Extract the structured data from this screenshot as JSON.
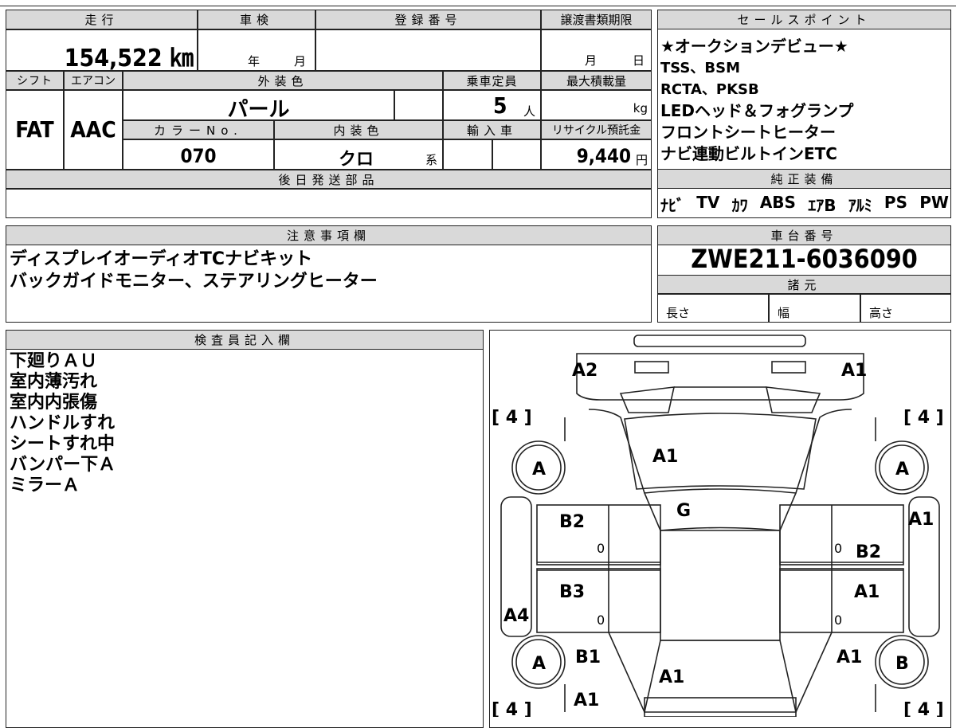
{
  "mileage": {
    "label": "走行",
    "value": "154,522 ㎞"
  },
  "inspection": {
    "label": "車検",
    "year": "年",
    "month": "月"
  },
  "registration": {
    "label": "登録番号"
  },
  "transfer_deadline": {
    "label": "譲渡書類期限",
    "month": "月",
    "day": "日"
  },
  "sales_points": {
    "label": "セールスポイント",
    "lines": [
      "★オークションデビュー★",
      "TSS、BSM",
      "RCTA、PKSB",
      "LEDヘッド＆フォグランプ",
      "フロントシートヒーター",
      "ナビ連動ビルトインETC"
    ]
  },
  "shift": {
    "label": "シフト",
    "value": "FAT"
  },
  "aircon": {
    "label": "エアコン",
    "value": "AAC"
  },
  "exterior_color": {
    "label": "外装色",
    "value": "パール"
  },
  "capacity": {
    "label": "乗車定員",
    "value": "5",
    "unit": "人"
  },
  "max_load": {
    "label": "最大積載量",
    "unit": "kg"
  },
  "color_no": {
    "label": "カラーNo.",
    "value": "070"
  },
  "interior_color": {
    "label": "内装色",
    "value": "クロ",
    "suffix": "系"
  },
  "import": {
    "label": "輸入車"
  },
  "recycle": {
    "label": "リサイクル預託金",
    "value": "9,440",
    "unit": "円"
  },
  "later_parts": {
    "label": "後日発送部品"
  },
  "genuine_equipment": {
    "label": "純正装備",
    "items": [
      "ﾅﾋﾞ",
      "TV",
      "ｶﾜ",
      "ABS",
      "ｴｱB",
      "ｱﾙﾐ",
      "PS",
      "PW"
    ]
  },
  "notes": {
    "label": "注意事項欄",
    "lines": [
      "ディスプレイオーディオTCナビキット",
      "バックガイドモニター、ステアリングヒーター"
    ]
  },
  "chassis": {
    "label": "車台番号",
    "value": "ZWE211-6036090"
  },
  "specs": {
    "label": "諸元",
    "length": "長さ",
    "width": "幅",
    "height": "高さ"
  },
  "inspector": {
    "label": "検査員記入欄",
    "lines": [
      "下廻りＡＵ",
      "室内薄汚れ",
      "室内内張傷",
      "ハンドルすれ",
      "シートすれ中",
      "バンパー下Ａ",
      "ミラーＡ"
    ]
  },
  "diagram": {
    "tread_fl": "[ 4 ]",
    "tread_fr": "[ 4 ]",
    "tread_rl": "[ 4 ]",
    "tread_rr": "[ 4 ]",
    "front_left_corner": "A2",
    "front_right_corner": "A1",
    "hood": "A1",
    "windshield": "G",
    "wheel_fl": "A",
    "wheel_fr": "A",
    "wheel_rl": "A",
    "wheel_rr": "B",
    "door_fl": "B2",
    "door_fr": "B2",
    "door_rl": "B3",
    "door_rr": "A1",
    "fender_fr": "A1",
    "side_left": "A4",
    "quarter_rl": "B1",
    "quarter_rr": "A1",
    "trunk": "A1",
    "rear_bumper_l": "A1",
    "handle_fl": "0",
    "handle_fr": "0",
    "handle_rl": "0",
    "handle_rr": "0"
  }
}
